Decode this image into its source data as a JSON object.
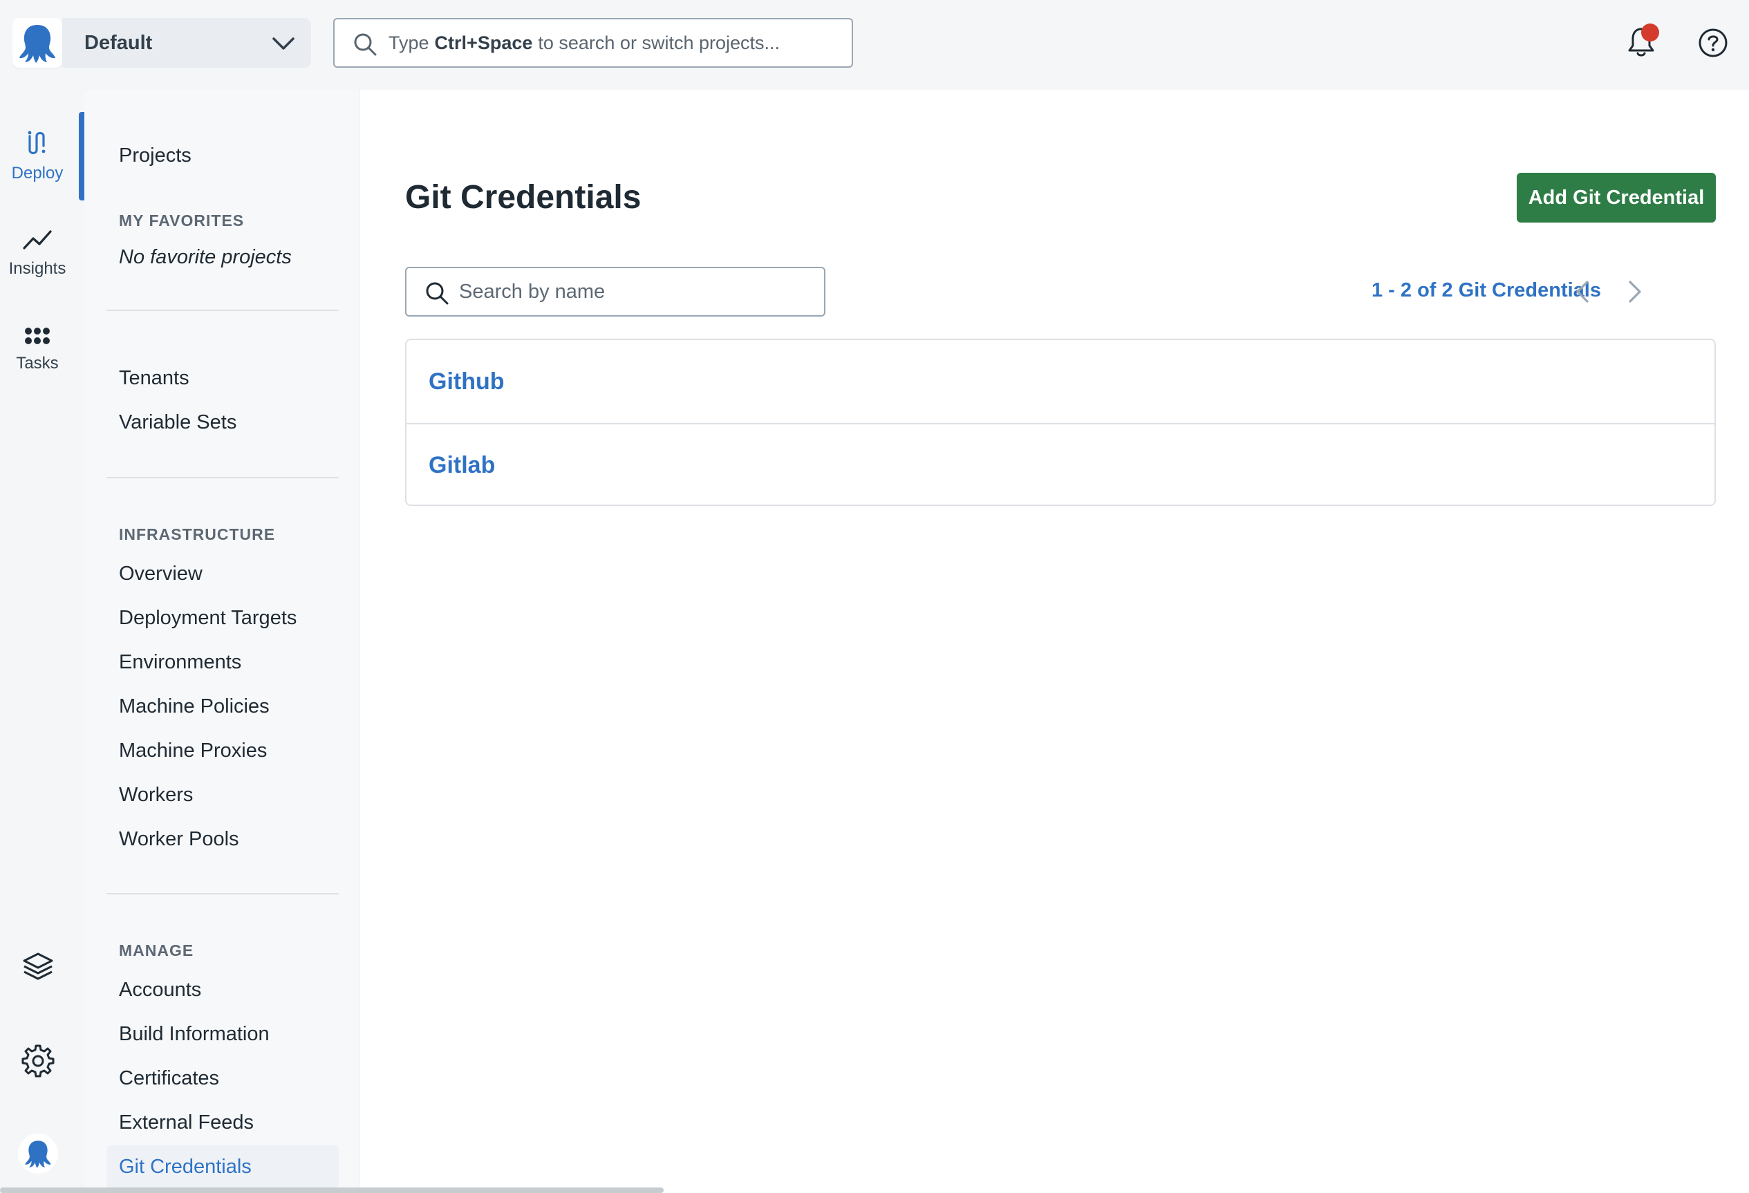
{
  "topbar": {
    "space_name": "Default",
    "search_prefix": "Type",
    "search_shortcut": "Ctrl+Space",
    "search_suffix": "to search or switch projects..."
  },
  "rail": {
    "items": [
      {
        "label": "Deploy",
        "icon": "deploy-icon"
      },
      {
        "label": "Insights",
        "icon": "insights-icon"
      },
      {
        "label": "Tasks",
        "icon": "tasks-icon"
      }
    ],
    "bottom_icons": [
      "layers-icon",
      "gear-icon",
      "octopus-avatar-icon"
    ]
  },
  "sidebar": {
    "projects": "Projects",
    "favorites_heading": "MY FAVORITES",
    "favorites_empty": "No favorite projects",
    "tenants": "Tenants",
    "variable_sets": "Variable Sets",
    "infrastructure_heading": "INFRASTRUCTURE",
    "infrastructure_items": [
      "Overview",
      "Deployment Targets",
      "Environments",
      "Machine Policies",
      "Machine Proxies",
      "Workers",
      "Worker Pools"
    ],
    "manage_heading": "MANAGE",
    "manage_items": [
      "Accounts",
      "Build Information",
      "Certificates",
      "External Feeds",
      "Git Credentials"
    ]
  },
  "main": {
    "title": "Git Credentials",
    "add_button": "Add Git Credential",
    "filter_placeholder": "Search by name",
    "pager_text": "1 - 2 of 2 Git Credentials",
    "credentials": [
      "Github",
      "Gitlab"
    ]
  },
  "colors": {
    "accent": "#2f72c4",
    "primary_button": "#2e7d46",
    "notification_dot": "#d33b2c"
  }
}
